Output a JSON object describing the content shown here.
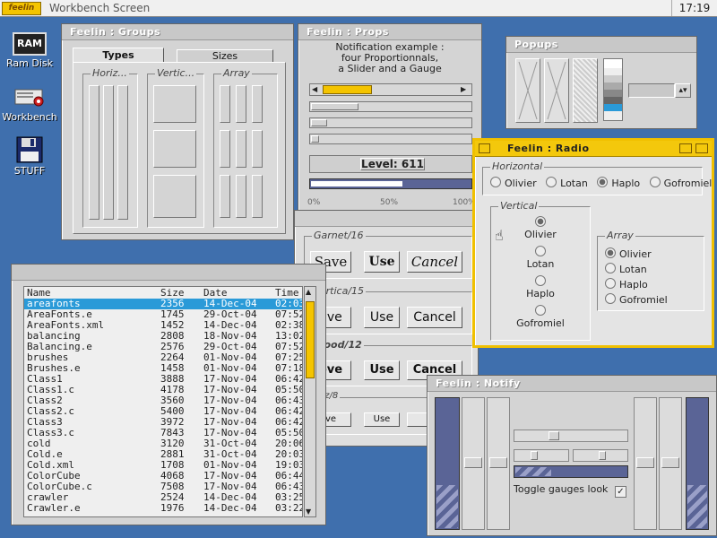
{
  "screen": {
    "title": "Workbench Screen",
    "logo": "feelin",
    "clock": "17:19"
  },
  "desktop_icons": [
    {
      "label": "Ram Disk",
      "icon": "ram-disk-icon",
      "badge": "RAM"
    },
    {
      "label": "Workbench",
      "icon": "workbench-drive-icon"
    },
    {
      "label": "STUFF",
      "icon": "floppy-disk-icon"
    }
  ],
  "groups_win": {
    "title": "Feelin : Groups",
    "tabs": [
      "Types",
      "Sizes"
    ],
    "groups": [
      "Horiz...",
      "Vertic...",
      "Array"
    ]
  },
  "props_win": {
    "title": "Feelin : Props",
    "notice": [
      "Notification example :",
      "four Proportionnals,",
      "a Slider and a Gauge"
    ],
    "level_label": "Level: 611",
    "gauge_ticks": [
      "0%",
      "50%",
      "100%"
    ],
    "props": [
      0.29,
      0.09,
      0.04,
      0.0
    ],
    "slider_value": 0.35,
    "gauge_value": 0.58
  },
  "popups_win": {
    "title": "Popups"
  },
  "radio_win": {
    "title": "Feelin : Radio",
    "horizontal": {
      "label": "Horizontal",
      "items": [
        "Olivier",
        "Lotan",
        "Haplo",
        "Gofromiel"
      ],
      "selected": 2
    },
    "vertical": {
      "label": "Vertical",
      "items": [
        "Olivier",
        "Lotan",
        "Haplo",
        "Gofromiel"
      ],
      "selected": 0
    },
    "array": {
      "label": "Array",
      "items": [
        "Olivier",
        "Lotan",
        "Haplo",
        "Gofromiel"
      ],
      "selected": 0
    }
  },
  "fonts_win": {
    "groups": [
      {
        "label": "Garnet/16",
        "buttons": [
          "Save",
          "Use",
          "Cancel"
        ]
      },
      {
        "label": "Vertica/15",
        "buttons": [
          "ave",
          "Use",
          "Cancel"
        ]
      },
      {
        "label": "mood/12",
        "buttons": [
          "ove",
          "Use",
          "Cancel"
        ]
      },
      {
        "label": "aaz/8",
        "buttons": [
          "ve",
          "Use",
          "Ca"
        ]
      }
    ]
  },
  "filelist_win": {
    "columns": [
      "Name",
      "Size",
      "Date",
      "Time"
    ],
    "rows": [
      [
        "areafonts",
        "2356",
        "14-Dec-04",
        "02:03:28"
      ],
      [
        "AreaFonts.e",
        "1745",
        "29-Oct-04",
        "07:52:00"
      ],
      [
        "AreaFonts.xml",
        "1452",
        "14-Dec-04",
        "02:38:28"
      ],
      [
        "balancing",
        "2808",
        "18-Nov-04",
        "13:02:10"
      ],
      [
        "Balancing.e",
        "2576",
        "29-Oct-04",
        "07:52:00"
      ],
      [
        "brushes",
        "2264",
        "01-Nov-04",
        "07:25:40"
      ],
      [
        "Brushes.e",
        "1458",
        "01-Nov-04",
        "07:18:42"
      ],
      [
        "Class1",
        "3888",
        "17-Nov-04",
        "06:42:24"
      ],
      [
        "Class1.c",
        "4178",
        "17-Nov-04",
        "05:50:06"
      ],
      [
        "Class2",
        "3560",
        "17-Nov-04",
        "06:43:56"
      ],
      [
        "Class2.c",
        "5400",
        "17-Nov-04",
        "06:42:44"
      ],
      [
        "Class3",
        "3972",
        "17-Nov-04",
        "06:42:58"
      ],
      [
        "Class3.c",
        "7843",
        "17-Nov-04",
        "05:50:04"
      ],
      [
        "cold",
        "3120",
        "31-Oct-04",
        "20:06:16"
      ],
      [
        "Cold.e",
        "2881",
        "31-Oct-04",
        "20:03:16"
      ],
      [
        "Cold.xml",
        "1708",
        "01-Nov-04",
        "19:03:16"
      ],
      [
        "ColorCube",
        "4068",
        "17-Nov-04",
        "06:44:14"
      ],
      [
        "ColorCube.c",
        "7508",
        "17-Nov-04",
        "06:43:32"
      ],
      [
        "crawler",
        "2524",
        "14-Dec-04",
        "03:25:54"
      ],
      [
        "Crawler.e",
        "1976",
        "14-Dec-04",
        "03:22:32"
      ]
    ],
    "selected": 0
  },
  "notify_win": {
    "title": "Feelin : Notify",
    "toggle_label": "Toggle gauges look"
  },
  "colors": {
    "accent": "#f3c80c",
    "selection": "#2a9ad8",
    "gauge": "#5a6496",
    "desktop": "#3f6fad"
  }
}
